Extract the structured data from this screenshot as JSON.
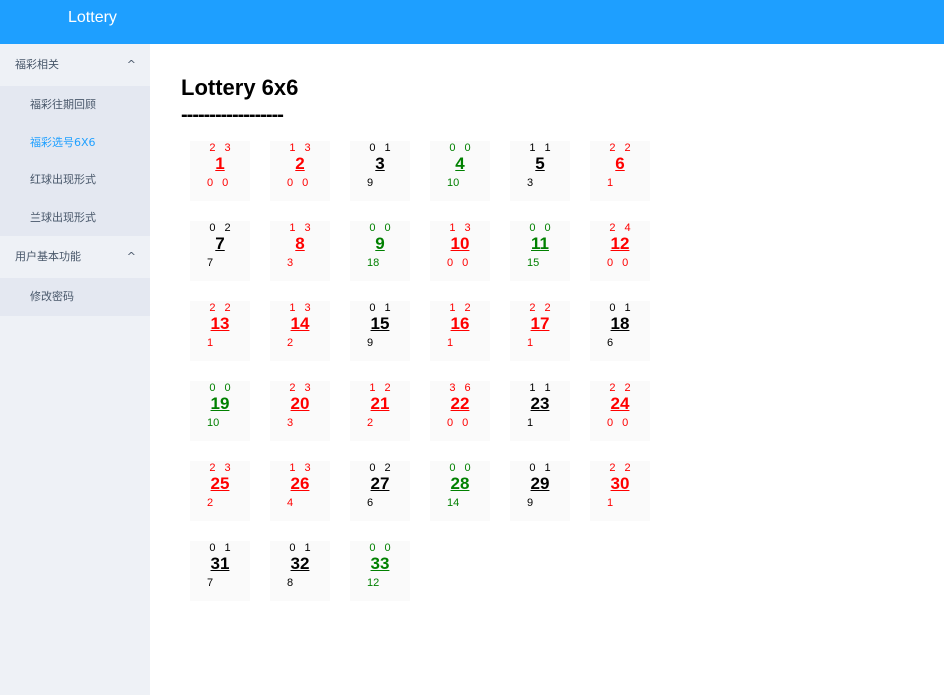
{
  "app": {
    "title": "Lottery"
  },
  "sidebar": {
    "groups": [
      {
        "label": "福彩相关",
        "chevron": "^",
        "items": [
          {
            "label": "福彩往期回顾",
            "active": false
          },
          {
            "label": "福彩选号6X6",
            "active": true
          },
          {
            "label": "红球出现形式",
            "active": false
          },
          {
            "label": "兰球出现形式",
            "active": false
          }
        ]
      },
      {
        "label": "用户基本功能",
        "chevron": "^",
        "items": [
          {
            "label": "修改密码",
            "active": false
          }
        ]
      }
    ]
  },
  "main": {
    "title": "Lottery 6x6",
    "divider": "------------------"
  },
  "colors": {
    "red": "#ff0000",
    "green": "#008000",
    "black": "#000000",
    "accent": "#1e9fff",
    "active": "#20a0ff"
  },
  "cells": [
    {
      "n": "1",
      "color": "red",
      "top": "2 3",
      "bottom": "0 0",
      "bottom_align": "left"
    },
    {
      "n": "2",
      "color": "red",
      "top": "1 3",
      "bottom": "0 0",
      "bottom_align": "left"
    },
    {
      "n": "3",
      "color": "black",
      "top": "0 1",
      "bottom": "9",
      "bottom_align": "left"
    },
    {
      "n": "4",
      "color": "green",
      "top": "0 0",
      "bottom": "10",
      "bottom_align": "left"
    },
    {
      "n": "5",
      "color": "black",
      "top": "1 1",
      "bottom": "3",
      "bottom_align": "left"
    },
    {
      "n": "6",
      "color": "red",
      "top": "2 2",
      "bottom": "1",
      "bottom_align": "right"
    },
    {
      "n": "7",
      "color": "black",
      "top": "0 2",
      "bottom": "7",
      "bottom_align": "left"
    },
    {
      "n": "8",
      "color": "red",
      "top": "1 3",
      "bottom": "3",
      "bottom_align": "left"
    },
    {
      "n": "9",
      "color": "green",
      "top": "0 0",
      "bottom": "18",
      "bottom_align": "left"
    },
    {
      "n": "10",
      "color": "red",
      "top": "1 3",
      "bottom": "0 0",
      "bottom_align": "left"
    },
    {
      "n": "11",
      "color": "green",
      "top": "0 0",
      "bottom": "15",
      "bottom_align": "left"
    },
    {
      "n": "12",
      "color": "red",
      "top": "2 4",
      "bottom": "0 0",
      "bottom_align": "right"
    },
    {
      "n": "13",
      "color": "red",
      "top": "2 2",
      "bottom": "1",
      "bottom_align": "right"
    },
    {
      "n": "14",
      "color": "red",
      "top": "1 3",
      "bottom": "2",
      "bottom_align": "left"
    },
    {
      "n": "15",
      "color": "black",
      "top": "0 1",
      "bottom": "9",
      "bottom_align": "left"
    },
    {
      "n": "16",
      "color": "red",
      "top": "1 2",
      "bottom": "1",
      "bottom_align": "left"
    },
    {
      "n": "17",
      "color": "red",
      "top": "2 2",
      "bottom": "1",
      "bottom_align": "left"
    },
    {
      "n": "18",
      "color": "black",
      "top": "0 1",
      "bottom": "6",
      "bottom_align": "right"
    },
    {
      "n": "19",
      "color": "green",
      "top": "0 0",
      "bottom": "10",
      "bottom_align": "left"
    },
    {
      "n": "20",
      "color": "red",
      "top": "2 3",
      "bottom": "3",
      "bottom_align": "left"
    },
    {
      "n": "21",
      "color": "red",
      "top": "1 2",
      "bottom": "2",
      "bottom_align": "left"
    },
    {
      "n": "22",
      "color": "red",
      "top": "3 6",
      "bottom": "0 0",
      "bottom_align": "left"
    },
    {
      "n": "23",
      "color": "black",
      "top": "1 1",
      "bottom": "1",
      "bottom_align": "left"
    },
    {
      "n": "24",
      "color": "red",
      "top": "2 2",
      "bottom": "0 0",
      "bottom_align": "right"
    },
    {
      "n": "25",
      "color": "red",
      "top": "2 3",
      "bottom": "2",
      "bottom_align": "left"
    },
    {
      "n": "26",
      "color": "red",
      "top": "1 3",
      "bottom": "4",
      "bottom_align": "left"
    },
    {
      "n": "27",
      "color": "black",
      "top": "0 2",
      "bottom": "6",
      "bottom_align": "left"
    },
    {
      "n": "28",
      "color": "green",
      "top": "0 0",
      "bottom": "14",
      "bottom_align": "left"
    },
    {
      "n": "29",
      "color": "black",
      "top": "0 1",
      "bottom": "9",
      "bottom_align": "left"
    },
    {
      "n": "30",
      "color": "red",
      "top": "2 2",
      "bottom": "1",
      "bottom_align": "right"
    },
    {
      "n": "31",
      "color": "black",
      "top": "0 1",
      "bottom": "7",
      "bottom_align": "right"
    },
    {
      "n": "32",
      "color": "black",
      "top": "0 1",
      "bottom": "8",
      "bottom_align": "left"
    },
    {
      "n": "33",
      "color": "green",
      "top": "0 0",
      "bottom": "12",
      "bottom_align": "left"
    }
  ]
}
